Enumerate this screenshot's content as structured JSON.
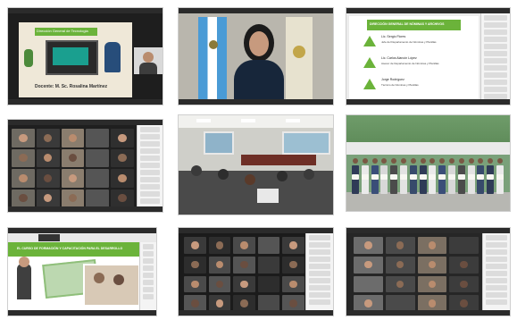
{
  "screenshot": {
    "tiles": [
      {
        "id": "tile-1",
        "banner": "Dirección General de Tecnologia",
        "caption": "Docente: M. Sc. Rosalina Martínez"
      },
      {
        "id": "tile-2",
        "caption": ""
      },
      {
        "id": "tile-3",
        "header": "DIRECCIÓN GENERAL DE NÓMINAS Y ARCHIVOS",
        "lines": [
          "Lic. Sergio Flores",
          "Jefe del Departamento de Nóminas y Planillas",
          "Lic. Carlos Alarcón López",
          "Asesor de Departamento de Nóminas y Planillas",
          "Jorge Rodríguez",
          "Técnico de Nóminas y Planillas"
        ]
      },
      {
        "id": "tile-4"
      },
      {
        "id": "tile-5"
      },
      {
        "id": "tile-6"
      },
      {
        "id": "tile-7",
        "text": "EL CURSO DE FORMACIÓN Y CAPACITACIÓN PARA EL DESARROLLO"
      },
      {
        "id": "tile-8"
      },
      {
        "id": "tile-9"
      }
    ]
  },
  "colors": {
    "dark": "#2b2b2b",
    "green": "#6bb33a",
    "window": "#e9e9e9",
    "sidebar": "#f4f4f4"
  }
}
